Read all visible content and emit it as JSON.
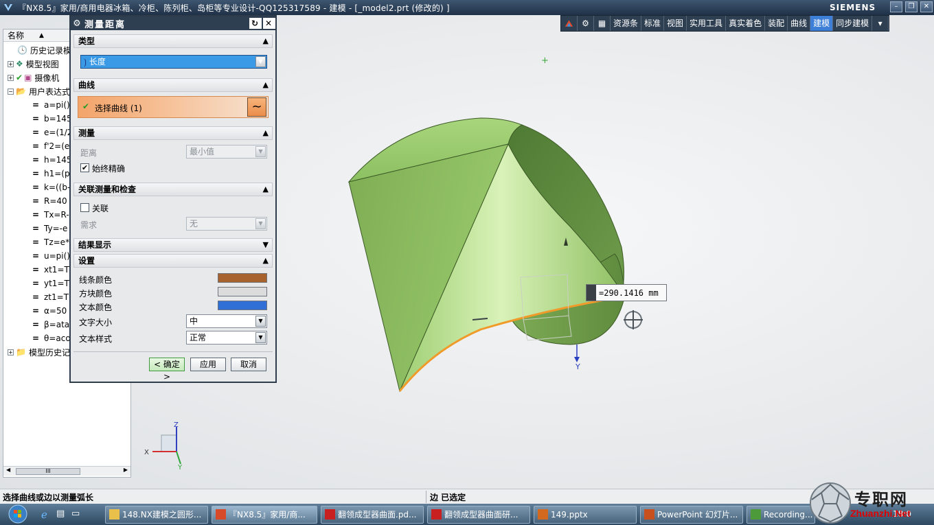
{
  "window": {
    "title": "『NX8.5』家用/商用电器冰箱、冷柜、陈列柜、岛柜等专业设计-QQ125317589 - 建模 - [_model2.prt  (修改的) ]",
    "brand": "SIEMENS"
  },
  "toolbar": {
    "items": [
      "资源条",
      "标准",
      "视图",
      "实用工具",
      "真实着色",
      "装配",
      "曲线",
      "建模",
      "同步建模"
    ],
    "active": "建模"
  },
  "navigator": {
    "column_header": "名称",
    "rows": [
      {
        "label": "历史记录模",
        "icon": "clock-icon"
      },
      {
        "label": "模型视图",
        "icon": "model-views-icon"
      },
      {
        "label": "摄像机",
        "icon": "camera-icon"
      },
      {
        "label": "用户表达式",
        "icon": "folder-open-icon"
      },
      {
        "label": "a=pi()"
      },
      {
        "label": "b=145"
      },
      {
        "label": "e=(1/2"
      },
      {
        "label": "f'2=(e"
      },
      {
        "label": "h=145"
      },
      {
        "label": "h1=(p"
      },
      {
        "label": "k=((b-"
      },
      {
        "label": "R=40"
      },
      {
        "label": "Tx=R-"
      },
      {
        "label": "Ty=-e"
      },
      {
        "label": "Tz=e*"
      },
      {
        "label": "u=pi()"
      },
      {
        "label": "xt1=T"
      },
      {
        "label": "yt1=T"
      },
      {
        "label": "zt1=T"
      },
      {
        "label": "α=50"
      },
      {
        "label": "β=atar"
      },
      {
        "label": "θ=aco"
      },
      {
        "label": "模型历史记",
        "icon": "folder-icon"
      }
    ],
    "scroll_thumb": "III"
  },
  "dialog": {
    "title": "测量距离",
    "sections": {
      "type": "类型",
      "curve": "曲线",
      "measure": "测量",
      "associative": "关联测量和检查",
      "results": "结果显示",
      "settings": "设置"
    },
    "type_value": "长度",
    "select_curve": "选择曲线 (1)",
    "distance_label": "距离",
    "distance_value": "最小值",
    "always_precise": "始终精确",
    "associative_label": "关联",
    "requirement_label": "需求",
    "requirement_value": "无",
    "line_color_label": "线条颜色",
    "block_color_label": "方块颜色",
    "text_color_label": "文本颜色",
    "text_size_label": "文字大小",
    "text_size_value": "中",
    "text_style_label": "文本样式",
    "text_style_value": "正常",
    "colors": {
      "line": "#a8622e",
      "block": "#dcdcdc",
      "text": "#2f6fd6"
    },
    "ok": "< 确定 >",
    "apply": "应用",
    "cancel": "取消"
  },
  "measurement": "=290.1416 mm",
  "axis_labels": {
    "y_main": "Y",
    "triad_z": "Z",
    "triad_x": "X",
    "triad_y": "Y"
  },
  "status": {
    "prompt": "选择曲线或边以测量弧长",
    "selection": "边 已选定"
  },
  "taskbar": {
    "tasks": [
      {
        "label": "148.NX建模之圆形...",
        "icon": "folder-icon"
      },
      {
        "label": "『NX8.5』家用/商...",
        "icon": "nx-icon"
      },
      {
        "label": "翻领成型器曲面.pd...",
        "icon": "pdf-icon"
      },
      {
        "label": "翻领成型器曲面研...",
        "icon": "pdf-icon"
      },
      {
        "label": "149.pptx",
        "icon": "pptx-icon"
      },
      {
        "label": "PowerPoint 幻灯片...",
        "icon": "powerpoint-icon"
      },
      {
        "label": "Recording...",
        "icon": "recording-icon"
      }
    ],
    "clock": "18:0"
  },
  "watermark": {
    "cn": "专职网",
    "en": "Zhuanzhi.Net"
  }
}
